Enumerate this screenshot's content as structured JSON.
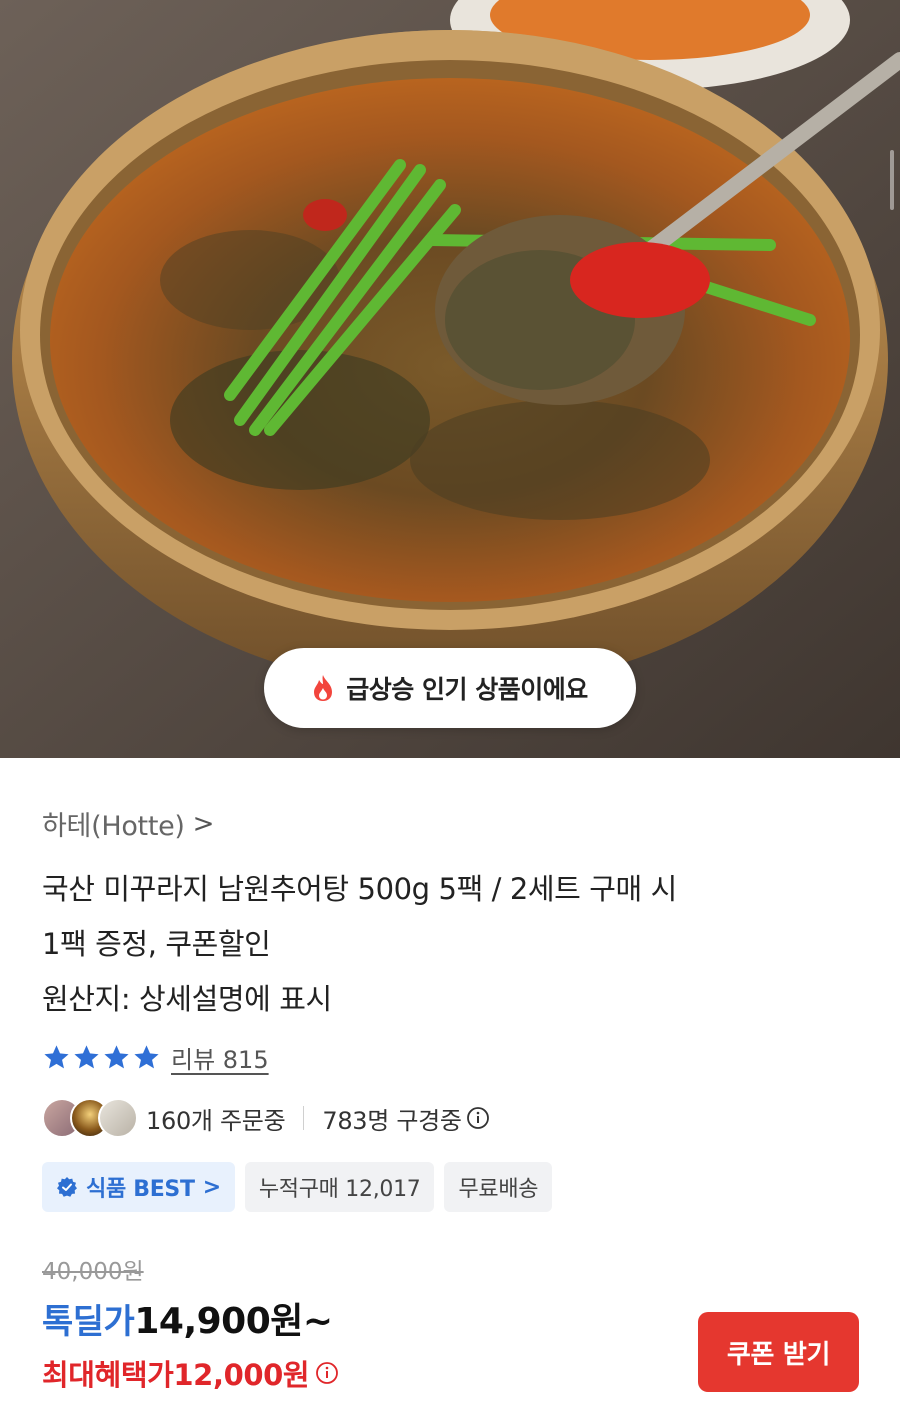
{
  "hero": {
    "trend_badge": "급상승 인기 상품이에요",
    "trend_icon": "fire-icon"
  },
  "product": {
    "brand": "하테(Hotte)",
    "brand_chevron": ">",
    "title_line1": "국산 미꾸라지 남원추어탕 500g 5팩 / 2세트 구매 시",
    "title_line2": "1팩 증정, 쿠폰할인",
    "title_line3": "원산지: 상세설명에 표시",
    "rating_stars": 4,
    "review_label": "리뷰 815"
  },
  "social": {
    "ordering": "160개 주문중",
    "viewing": "783명 구경중"
  },
  "badges": {
    "best": "식품 BEST",
    "best_chevron": ">",
    "cumulative": "누적구매 12,017",
    "shipping": "무료배송"
  },
  "price": {
    "original": "40,000원",
    "deal_label": "톡딜가",
    "deal_price": "14,900원~",
    "max_benefit_label": "최대혜택가",
    "max_benefit_price": "12,000원"
  },
  "actions": {
    "coupon_button": "쿠폰 받기"
  },
  "colors": {
    "accent_blue": "#2d6fd2",
    "accent_red": "#e0262a",
    "button_red": "#e5372f",
    "star_blue": "#2f6fd6"
  }
}
